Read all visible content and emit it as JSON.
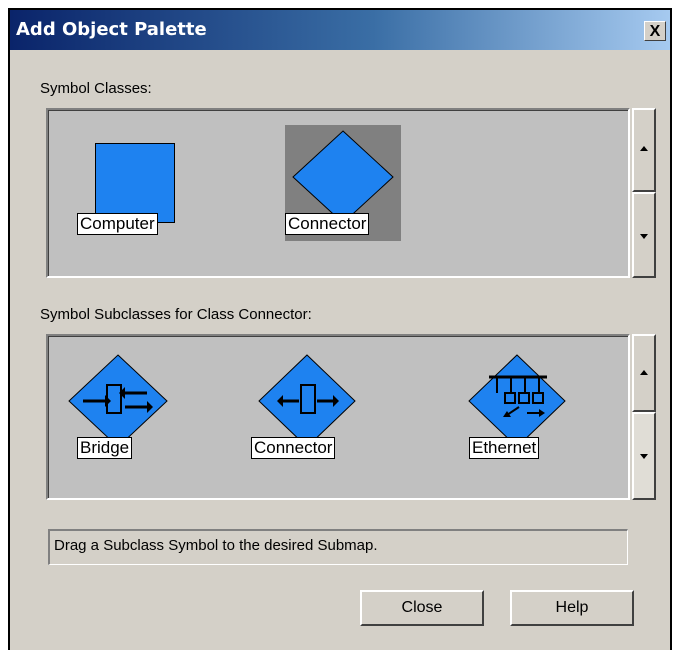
{
  "window": {
    "title": "Add Object Palette",
    "close_glyph": "X"
  },
  "symbol_classes": {
    "label": "Symbol Classes:",
    "items": [
      {
        "label": "Computer",
        "icon": "computer-square-icon"
      },
      {
        "label": "Connector",
        "icon": "connector-diamond-icon",
        "selected": true
      }
    ]
  },
  "subclasses": {
    "label": "Symbol Subclasses for Class Connector:",
    "items": [
      {
        "label": "Bridge",
        "icon": "bridge-icon"
      },
      {
        "label": "Connector",
        "icon": "connector-icon"
      },
      {
        "label": "Ethernet",
        "icon": "ethernet-icon"
      }
    ]
  },
  "status": {
    "text": "Drag a Subclass Symbol to the desired Submap."
  },
  "buttons": {
    "close": "Close",
    "help": "Help"
  },
  "colors": {
    "symbol_blue": "#1e82f0",
    "selected_bg": "#808080",
    "panel_bg": "#c0c0c0"
  }
}
